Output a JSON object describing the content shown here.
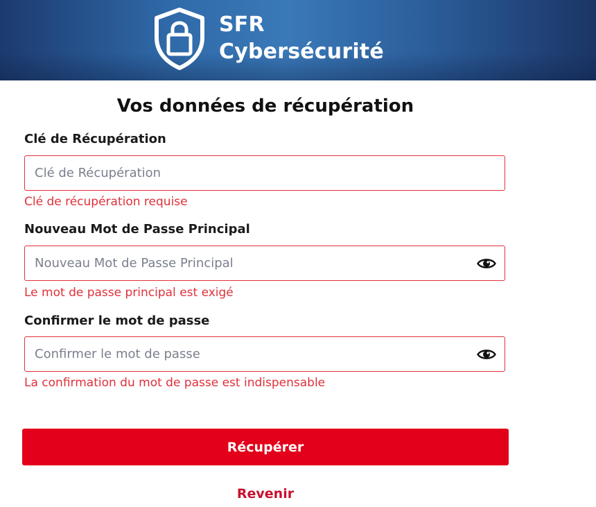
{
  "header": {
    "brand_line1": "SFR",
    "brand_line2": "Cybersécurité",
    "logo_icon": "shield-lock-icon"
  },
  "form": {
    "title": "Vos données de récupération",
    "recovery_key": {
      "label": "Clé de Récupération",
      "placeholder": "Clé de Récupération",
      "value": "",
      "error": "Clé de récupération requise"
    },
    "new_password": {
      "label": "Nouveau Mot de Passe Principal",
      "placeholder": "Nouveau Mot de Passe Principal",
      "value": "",
      "error": "Le mot de passe principal est exigé",
      "toggle_icon": "eye-icon"
    },
    "confirm_password": {
      "label": "Confirmer le mot de passe",
      "placeholder": "Confirmer le mot de passe",
      "value": "",
      "error": "La confirmation du mot de passe est indispensable",
      "toggle_icon": "eye-icon"
    },
    "submit_label": "Récupérer",
    "back_label": "Revenir"
  },
  "colors": {
    "accent_red": "#e2001a",
    "error_red": "#e0303a",
    "header_blue": "#2f69a8"
  }
}
